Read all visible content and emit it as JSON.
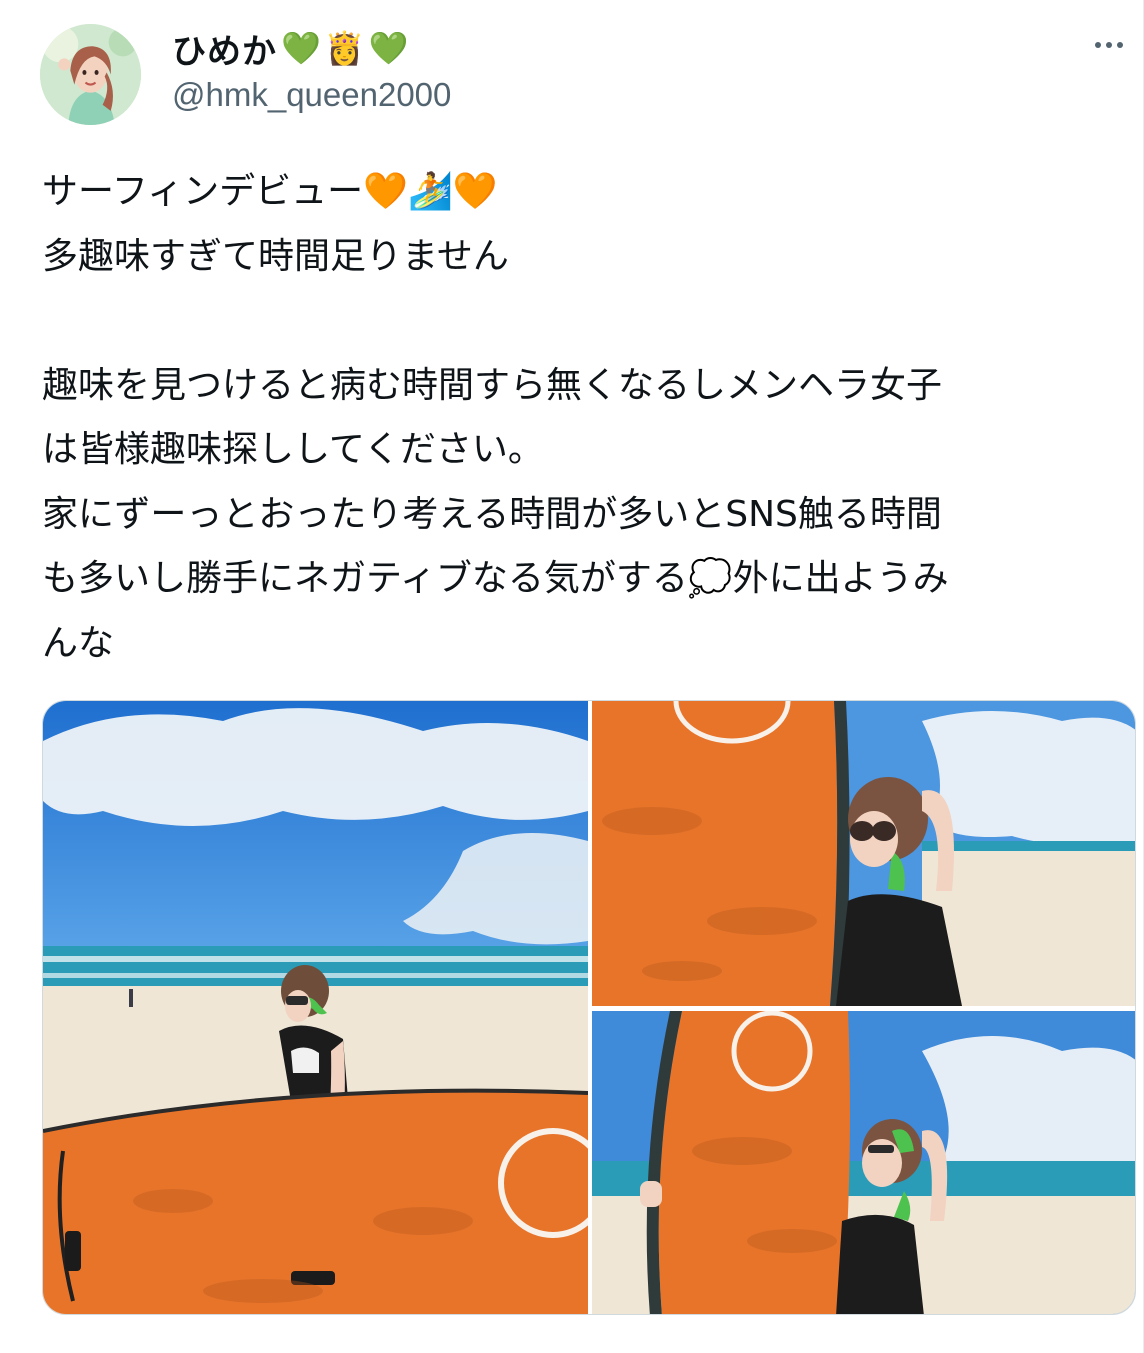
{
  "author": {
    "display_name": "ひめか",
    "name_emojis": [
      "💚",
      "👸",
      "💚"
    ],
    "handle": "@hmk_queen2000",
    "avatar_icon": "profile-photo"
  },
  "menu": {
    "more_icon": "more-dots-icon"
  },
  "tweet": {
    "line1": "サーフィンデビュー",
    "line1_emojis": [
      "🧡",
      "🏄",
      "🧡"
    ],
    "line2": "多趣味すぎて時間足りません",
    "para2_line1": "趣味を見つけると病む時間すら無くなるしメンヘラ女子",
    "para2_line2": "は皆様趣味探ししてください。",
    "para2_line3": "家にずーっとおったり考える時間が多いとSNS触る時間",
    "para2_line4a": "も多いし勝手にネガティブなる気がする",
    "para2_line4_emoji": "💭",
    "para2_line4b": "外に出ようみ",
    "para2_line5": "んな"
  },
  "media": {
    "photos": [
      {
        "label": "beach-surfboard-carry-photo"
      },
      {
        "label": "surfboard-standing-photo"
      },
      {
        "label": "surfboard-lookup-photo"
      }
    ]
  },
  "colors": {
    "text": "#0f1419",
    "secondary": "#536471",
    "board_orange": "#e8742a",
    "sky": "#2f7fd6",
    "sand": "#efe6d6"
  }
}
